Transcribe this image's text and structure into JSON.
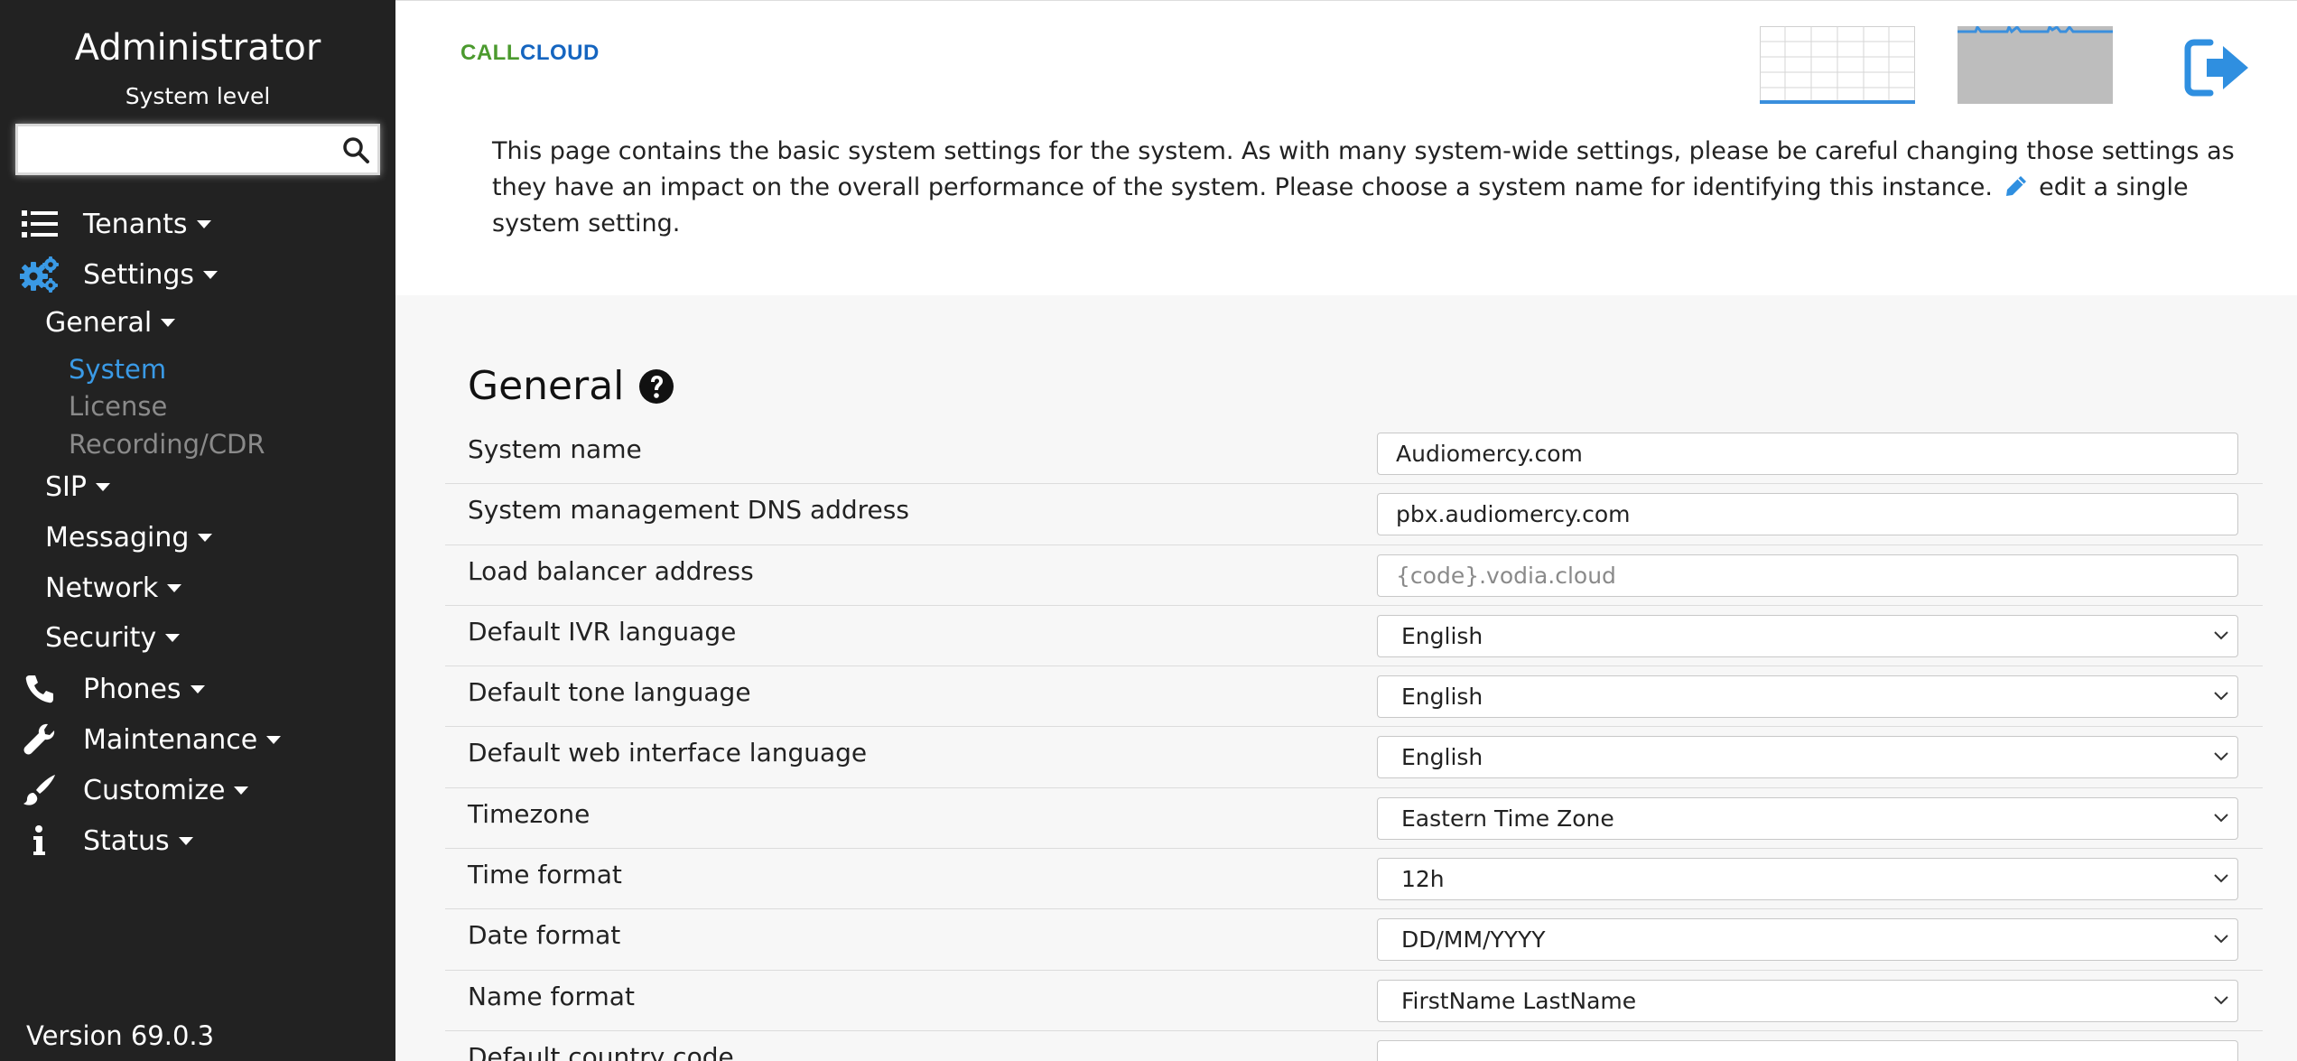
{
  "sidebar": {
    "title": "Administrator",
    "subtitle": "System level",
    "search": {
      "value": "",
      "placeholder": ""
    },
    "nav": {
      "tenants": "Tenants",
      "settings": "Settings",
      "general": "General",
      "system": "System",
      "license": "License",
      "recording": "Recording/CDR",
      "sip": "SIP",
      "messaging": "Messaging",
      "network": "Network",
      "security": "Security",
      "phones": "Phones",
      "maintenance": "Maintenance",
      "customize": "Customize",
      "status": "Status"
    },
    "version": "Version 69.0.3"
  },
  "header": {
    "logo_part1": "CALL",
    "logo_part2": "CLOUD",
    "logo_colors": {
      "call": "#4b9a2e",
      "cloud": "#1565c0"
    },
    "icons": [
      "grid-view-icon",
      "graph-view-icon",
      "logout-icon"
    ]
  },
  "description": {
    "text": "This page contains the basic system settings for the system. As with many system-wide settings, please be careful changing those settings as they have an impact on the overall performance of the system. Please choose a system name for identifying this instance.",
    "link_text": "edit a single system setting."
  },
  "section": {
    "title": "General"
  },
  "settings": [
    {
      "label": "System name",
      "type": "text",
      "value": "Audiomercy.com",
      "placeholder": ""
    },
    {
      "label": "System management DNS address",
      "type": "text",
      "value": "pbx.audiomercy.com",
      "placeholder": ""
    },
    {
      "label": "Load balancer address",
      "type": "text",
      "value": "",
      "placeholder": "{code}.vodia.cloud"
    },
    {
      "label": "Default IVR language",
      "type": "select",
      "value": "English"
    },
    {
      "label": "Default tone language",
      "type": "select",
      "value": "English"
    },
    {
      "label": "Default web interface language",
      "type": "select",
      "value": "English"
    },
    {
      "label": "Timezone",
      "type": "select",
      "value": "Eastern Time Zone"
    },
    {
      "label": "Time format",
      "type": "select",
      "value": "12h"
    },
    {
      "label": "Date format",
      "type": "select",
      "value": "DD/MM/YYYY"
    },
    {
      "label": "Name format",
      "type": "select",
      "value": "FirstName LastName"
    },
    {
      "label": "Default country code",
      "type": "text",
      "value": "",
      "placeholder": ""
    }
  ],
  "colors": {
    "sidebar_bg": "#222222",
    "accent": "#3a9ae6",
    "logout": "#2f8fe0"
  }
}
